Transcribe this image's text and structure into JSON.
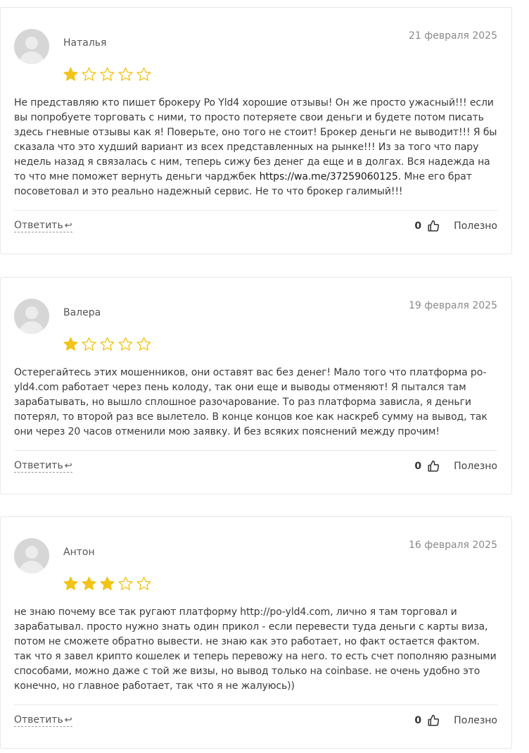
{
  "reviews": [
    {
      "author": "Наталья",
      "date": "21 февраля 2025",
      "rating": 1,
      "text_before": "Не представляю кто пишет брокеру Po Yld4 хорошие отзывы! Он же просто ужасный!!! если вы попробуете торговать с ними, то просто потеряете свои деньги и будете потом писать здесь гневные отзывы как я! Поверьте, оно того не стоит! Брокер деньги не выводит!!! Я бы сказала что это худший вариант из всех представленных на рынке!!! Из за того что пару недель назад я связалась с ним, теперь сижу без денег да еще и в долгах. Вся надежда на то что мне поможет вернуть деньги чарджбек ",
      "link": "https://wa.me/37259060125",
      "text_after": ". Мне его брат посоветовал и это реально надежный сервис. Не то что брокер галимый!!!",
      "reply_label": "Ответить",
      "likes": "0",
      "useful_label": "Полезно"
    },
    {
      "author": "Валера",
      "date": "19 февраля 2025",
      "rating": 1,
      "text_before": "Остерегайтесь этих мошенников, они оставят вас без денег! Мало того что платформа po-yld4.com работает через пень колоду, так они еще и выводы отменяют! Я пытался там зарабатывать, но вышло сплошное разочарование. То раз платформа зависла, я деньги потерял, то второй раз все вылетело. В конце концов кое как наскреб сумму на вывод, так они через 20 часов отменили мою заявку. И без всяких пояснений между прочим!",
      "link": "",
      "text_after": "",
      "reply_label": "Ответить",
      "likes": "0",
      "useful_label": "Полезно"
    },
    {
      "author": "Антон",
      "date": "16 февраля 2025",
      "rating": 3,
      "text_before": "не знаю почему все так ругают платформу http://po-yld4.com, лично я там торговал и зарабатывал. просто нужно знать один прикол - если перевести туда деньги с карты виза, потом не сможете обратно вывести. не знаю как это работает, но факт остается фактом. так что я завел крипто кошелек и теперь перевожу на него. то есть счет пополняю разными способами, можно даже с той же визы, но вывод только на coinbase. не очень удобно это конечно, но главное работает, так что я не жалуюсь))",
      "link": "",
      "text_after": "",
      "reply_label": "Ответить",
      "likes": "0",
      "useful_label": "Полезно"
    }
  ],
  "max_rating": 5,
  "colors": {
    "star_filled": "#f2c418",
    "star_empty": "#f2c418",
    "border": "#e8e8e8"
  },
  "icons": {
    "reply": "reply-arrow-icon",
    "like": "thumbs-up-icon",
    "star": "star-icon"
  }
}
